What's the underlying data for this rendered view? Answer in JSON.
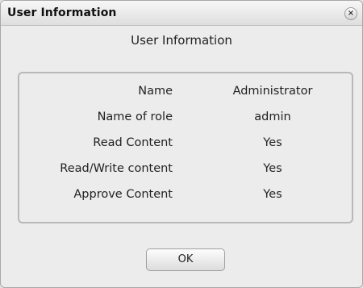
{
  "window": {
    "title": "User Information",
    "close_symbol": "×",
    "close_icon": "close-icon"
  },
  "main": {
    "heading": "User Information",
    "fields": [
      {
        "label": "Name",
        "value": "Administrator"
      },
      {
        "label": "Name of role",
        "value": "admin"
      },
      {
        "label": "Read Content",
        "value": "Yes"
      },
      {
        "label": "Read/Write content",
        "value": "Yes"
      },
      {
        "label": "Approve Content",
        "value": "Yes"
      }
    ]
  },
  "footer": {
    "ok_label": "OK"
  }
}
